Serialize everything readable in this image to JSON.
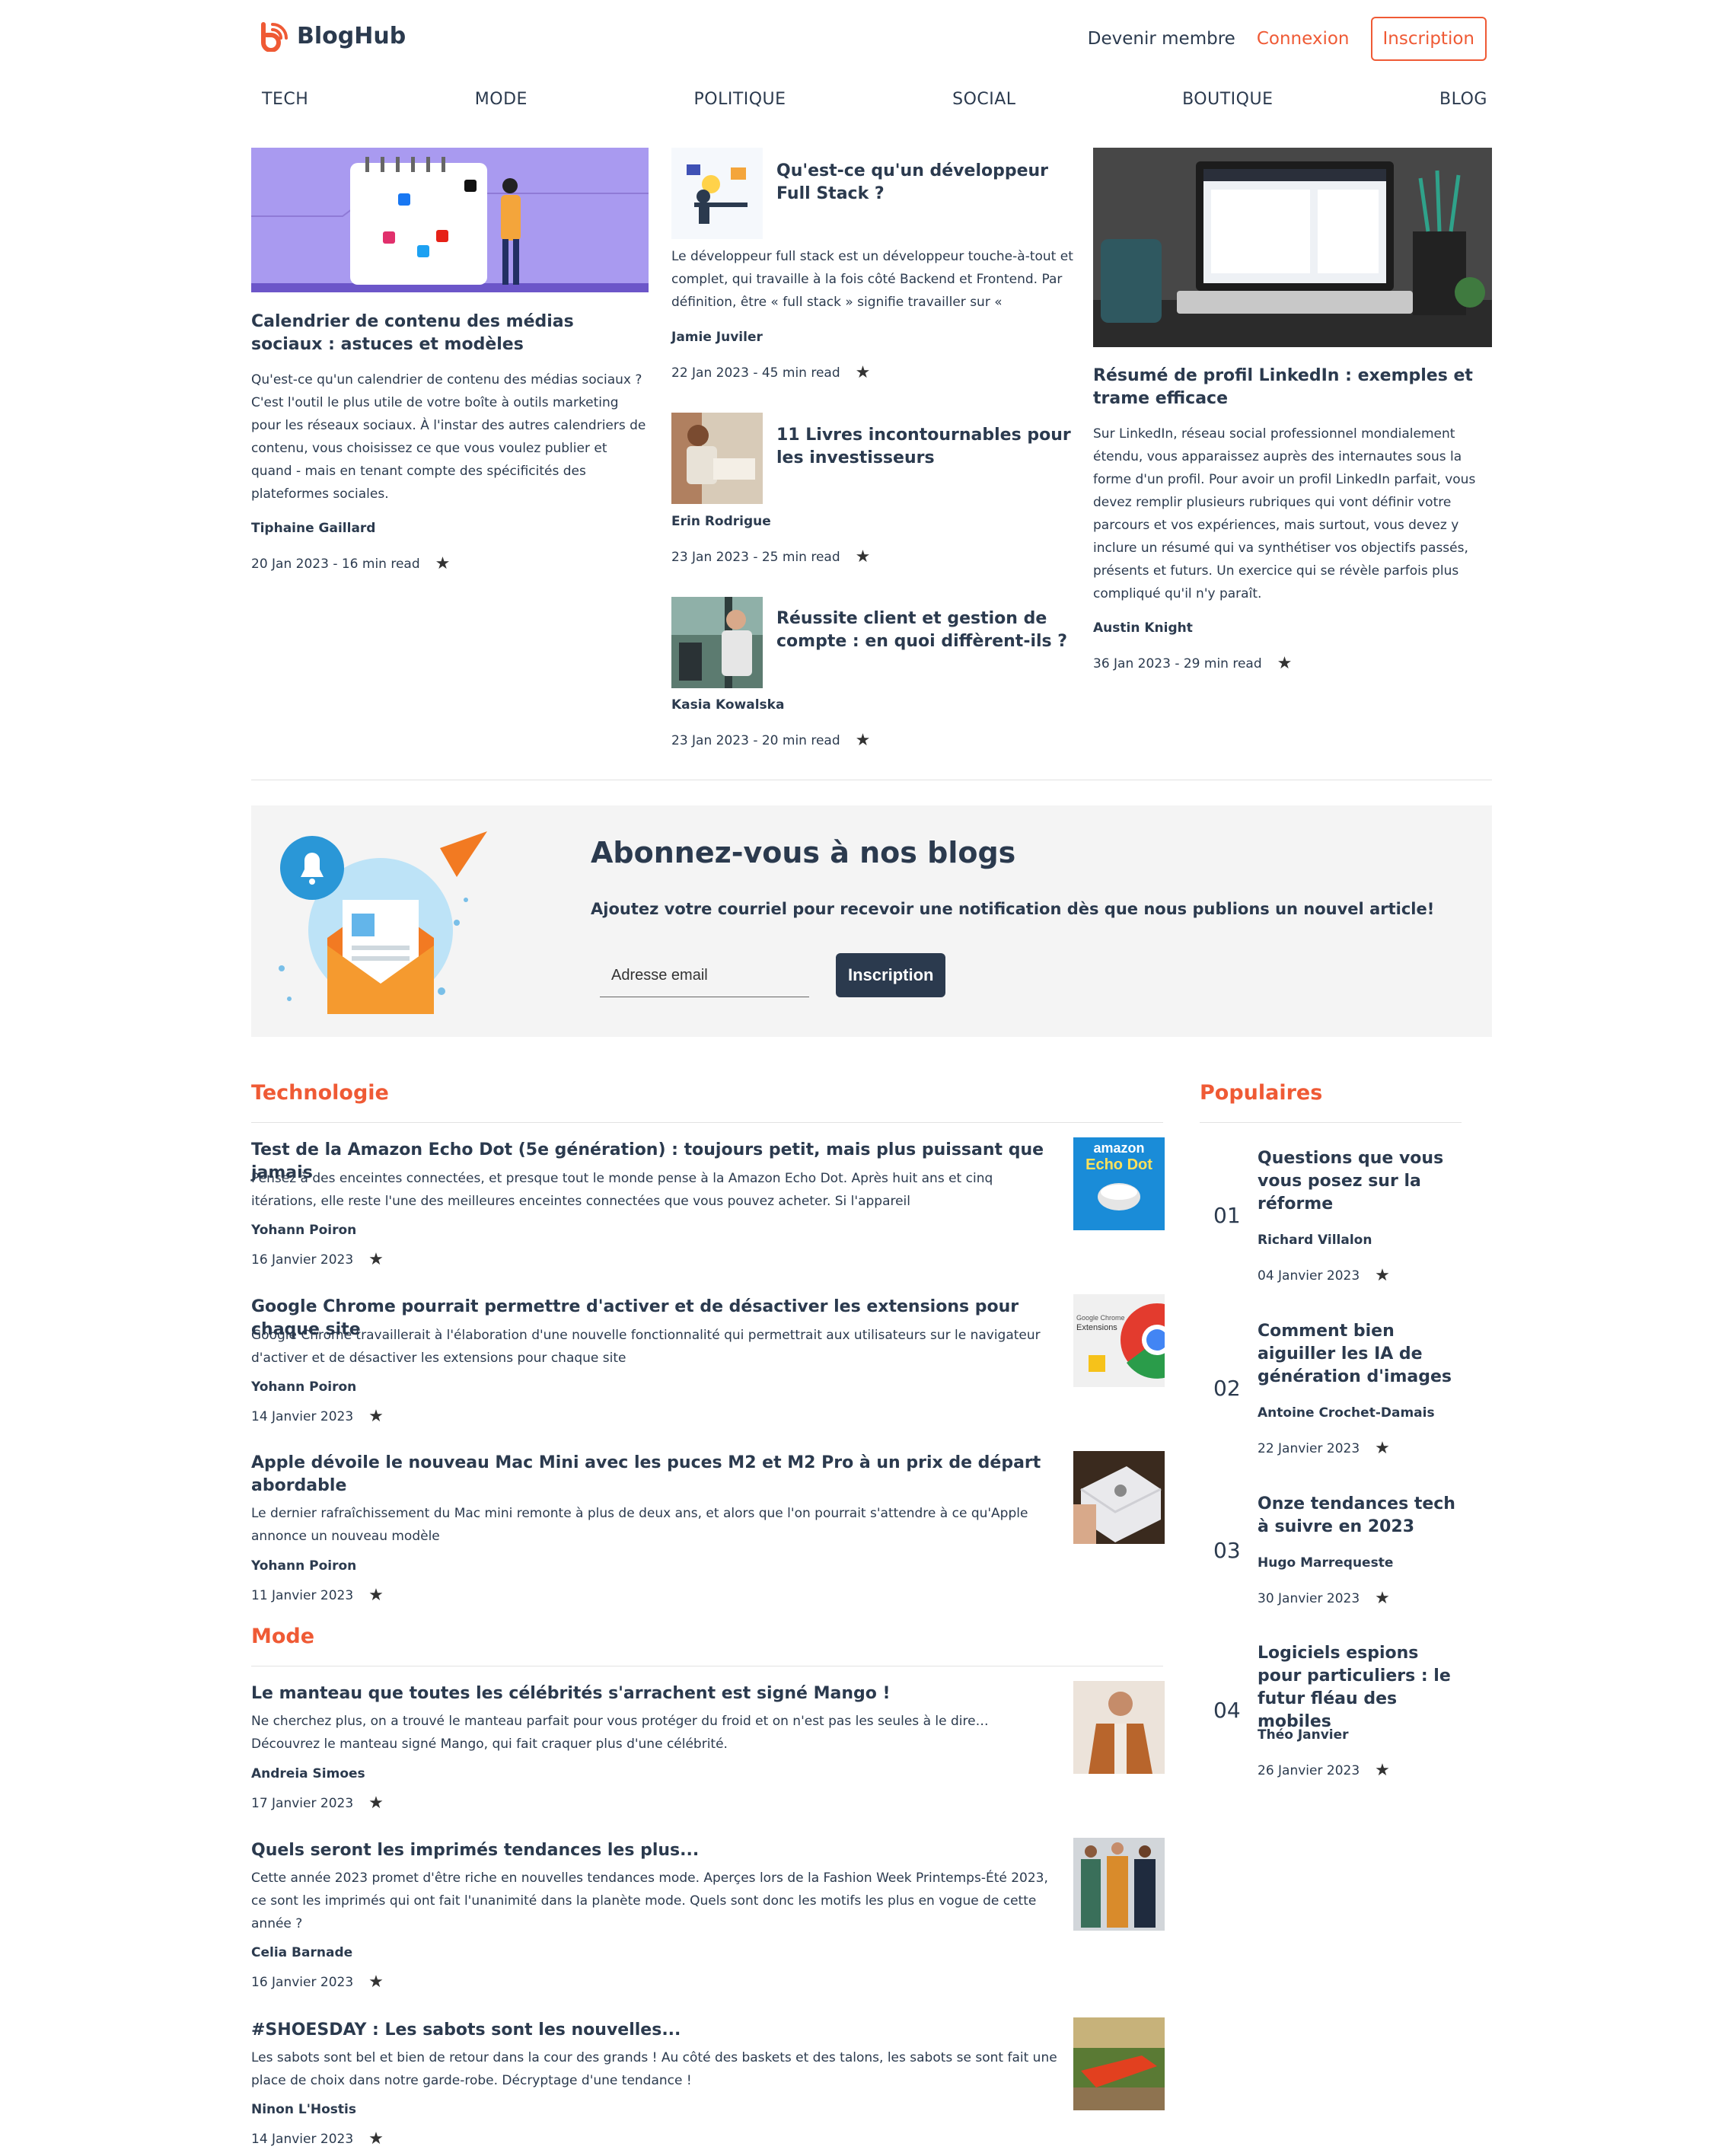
{
  "brand": {
    "name": "BlogHub"
  },
  "header": {
    "become_member": "Devenir membre",
    "login": "Connexion",
    "signup": "Inscription"
  },
  "categories": [
    "TECH",
    "MODE",
    "POLITIQUE",
    "SOCIAL",
    "BOUTIQUE",
    "BLOG"
  ],
  "featured": {
    "left": {
      "title": "Calendrier de contenu des médias sociaux : astuces et modèles",
      "excerpt": "Qu'est-ce qu'un calendrier de contenu des médias sociaux ? C'est l'outil le plus utile de votre boîte à outils marketing pour les réseaux sociaux. À l'instar des autres calendriers de contenu, vous choisissez ce que vous voulez publier et quand - mais en tenant compte des spécificités des plateformes sociales.",
      "author": "Tiphaine Gaillard",
      "meta": "20 Jan 2023 - 16 min read"
    },
    "middle": [
      {
        "title": "Qu'est-ce qu'un développeur Full Stack ?",
        "excerpt": "Le développeur full stack est un développeur touche-à-tout et complet, qui travaille à la fois côté Backend et Frontend. Par définition, être « full stack » signifie travailler sur «",
        "author": "Jamie Juviler",
        "meta": "22 Jan 2023 - 45 min read"
      },
      {
        "title": "11 Livres incontournables pour les investisseurs",
        "author": "Erin Rodrigue",
        "meta": "23 Jan 2023 - 25 min read"
      },
      {
        "title": "Réussite client et gestion de compte : en quoi diffèrent-ils ?",
        "author": "Kasia Kowalska",
        "meta": "23 Jan 2023 - 20 min read"
      }
    ],
    "right": {
      "title": "Résumé de profil LinkedIn : exemples et trame efficace",
      "excerpt": "Sur LinkedIn, réseau social professionnel mondialement étendu, vous apparaissez auprès des internautes sous la forme d'un profil. Pour avoir un profil LinkedIn parfait, vous devez remplir plusieurs rubriques qui vont définir votre parcours et vos expériences, mais surtout, vous devez y inclure un résumé qui va synthétiser vos objectifs passés, présents et futurs. Un exercice qui se révèle parfois plus compliqué qu'il n'y paraît.",
      "author": "Austin Knight",
      "meta": "36 Jan 2023 - 29 min read"
    }
  },
  "newsletter": {
    "title": "Abonnez-vous à nos blogs",
    "subtitle": "Ajoutez votre courriel pour recevoir une notification dès que nous publions un nouvel article!",
    "placeholder": "Adresse email",
    "button": "Inscription"
  },
  "tech": {
    "heading": "Technologie",
    "articles": [
      {
        "title": "Test de la Amazon Echo Dot (5e génération) : toujours petit, mais plus puissant que jamais",
        "excerpt": "Pensez à des enceintes connectées, et presque tout le monde pense à la Amazon Echo Dot. Après huit ans et cinq itérations, elle reste l'une des meilleures enceintes connectées que vous pouvez acheter. Si l'appareil",
        "author": "Yohann Poiron",
        "date": "16 Janvier 2023",
        "thumb_text1": "amazon",
        "thumb_text2": "Echo Dot"
      },
      {
        "title": "Google Chrome pourrait permettre d'activer et de désactiver les extensions pour chaque site",
        "excerpt": "Google Chrome travaillerait à l'élaboration d'une nouvelle fonctionnalité qui permettrait aux utilisateurs sur le navigateur d'activer et de désactiver les extensions pour chaque site",
        "author": "Yohann Poiron",
        "date": "14 Janvier 2023",
        "thumb_text1": "Google Chrome",
        "thumb_text2": "Extensions"
      },
      {
        "title": "Apple dévoile le nouveau Mac Mini avec les puces M2 et M2 Pro à un prix de départ abordable",
        "excerpt": "Le dernier rafraîchissement du Mac mini remonte à plus de deux ans, et alors que l'on pourrait s'attendre à ce qu'Apple annonce un nouveau modèle",
        "author": "Yohann Poiron",
        "date": "11 Janvier 2023"
      }
    ]
  },
  "mode": {
    "heading": "Mode",
    "articles": [
      {
        "title": "Le manteau que toutes les célébrités s'arrachent est signé Mango !",
        "excerpt": "Ne cherchez plus, on a trouvé le manteau parfait pour vous protéger du froid et on n'est pas les seules à le dire… Découvrez le manteau signé Mango, qui fait craquer plus d'une célébrité.",
        "author": "Andreia Simoes",
        "date": "17 Janvier 2023"
      },
      {
        "title": "Quels seront les imprimés tendances les plus...",
        "excerpt": "Cette année 2023 promet d'être riche en nouvelles tendances mode. Aperçes lors de la Fashion Week Printemps-Été 2023, ce sont les imprimés qui ont fait l'unanimité dans la planète mode. Quels sont donc les motifs les plus en vogue de cette année ?",
        "author": "Celia Barnade",
        "date": "16 Janvier 2023"
      },
      {
        "title": "#SHOESDAY : Les sabots sont les nouvelles...",
        "excerpt": "Les sabots sont bel et bien de retour dans la cour des grands ! Au côté des baskets et des talons, les sabots se sont fait une place de choix dans notre garde-robe. Décryptage d'une tendance !",
        "author": "Ninon L'Hostis",
        "date": "14 Janvier 2023"
      }
    ]
  },
  "popular": {
    "heading": "Populaires",
    "items": [
      {
        "num": "01",
        "title": "Questions que vous vous posez sur la réforme",
        "author": "Richard Villalon",
        "date": "04 Janvier 2023"
      },
      {
        "num": "02",
        "title": "Comment bien aiguiller les IA de génération d'images",
        "author": "Antoine Crochet-Damais",
        "date": "22 Janvier 2023"
      },
      {
        "num": "03",
        "title": "Onze tendances tech à suivre en 2023",
        "author": "Hugo Marrequeste",
        "date": "30 Janvier 2023"
      },
      {
        "num": "04",
        "title": "Logiciels espions pour particuliers : le futur fléau des mobiles",
        "author": "Théo Janvier",
        "date": "26 Janvier 2023"
      }
    ]
  },
  "colors": {
    "accent": "#ef5a35",
    "navy": "#2b3a4e",
    "panel": "#f4f4f4"
  },
  "icons": [
    "rss-logo-icon",
    "star-icon"
  ]
}
